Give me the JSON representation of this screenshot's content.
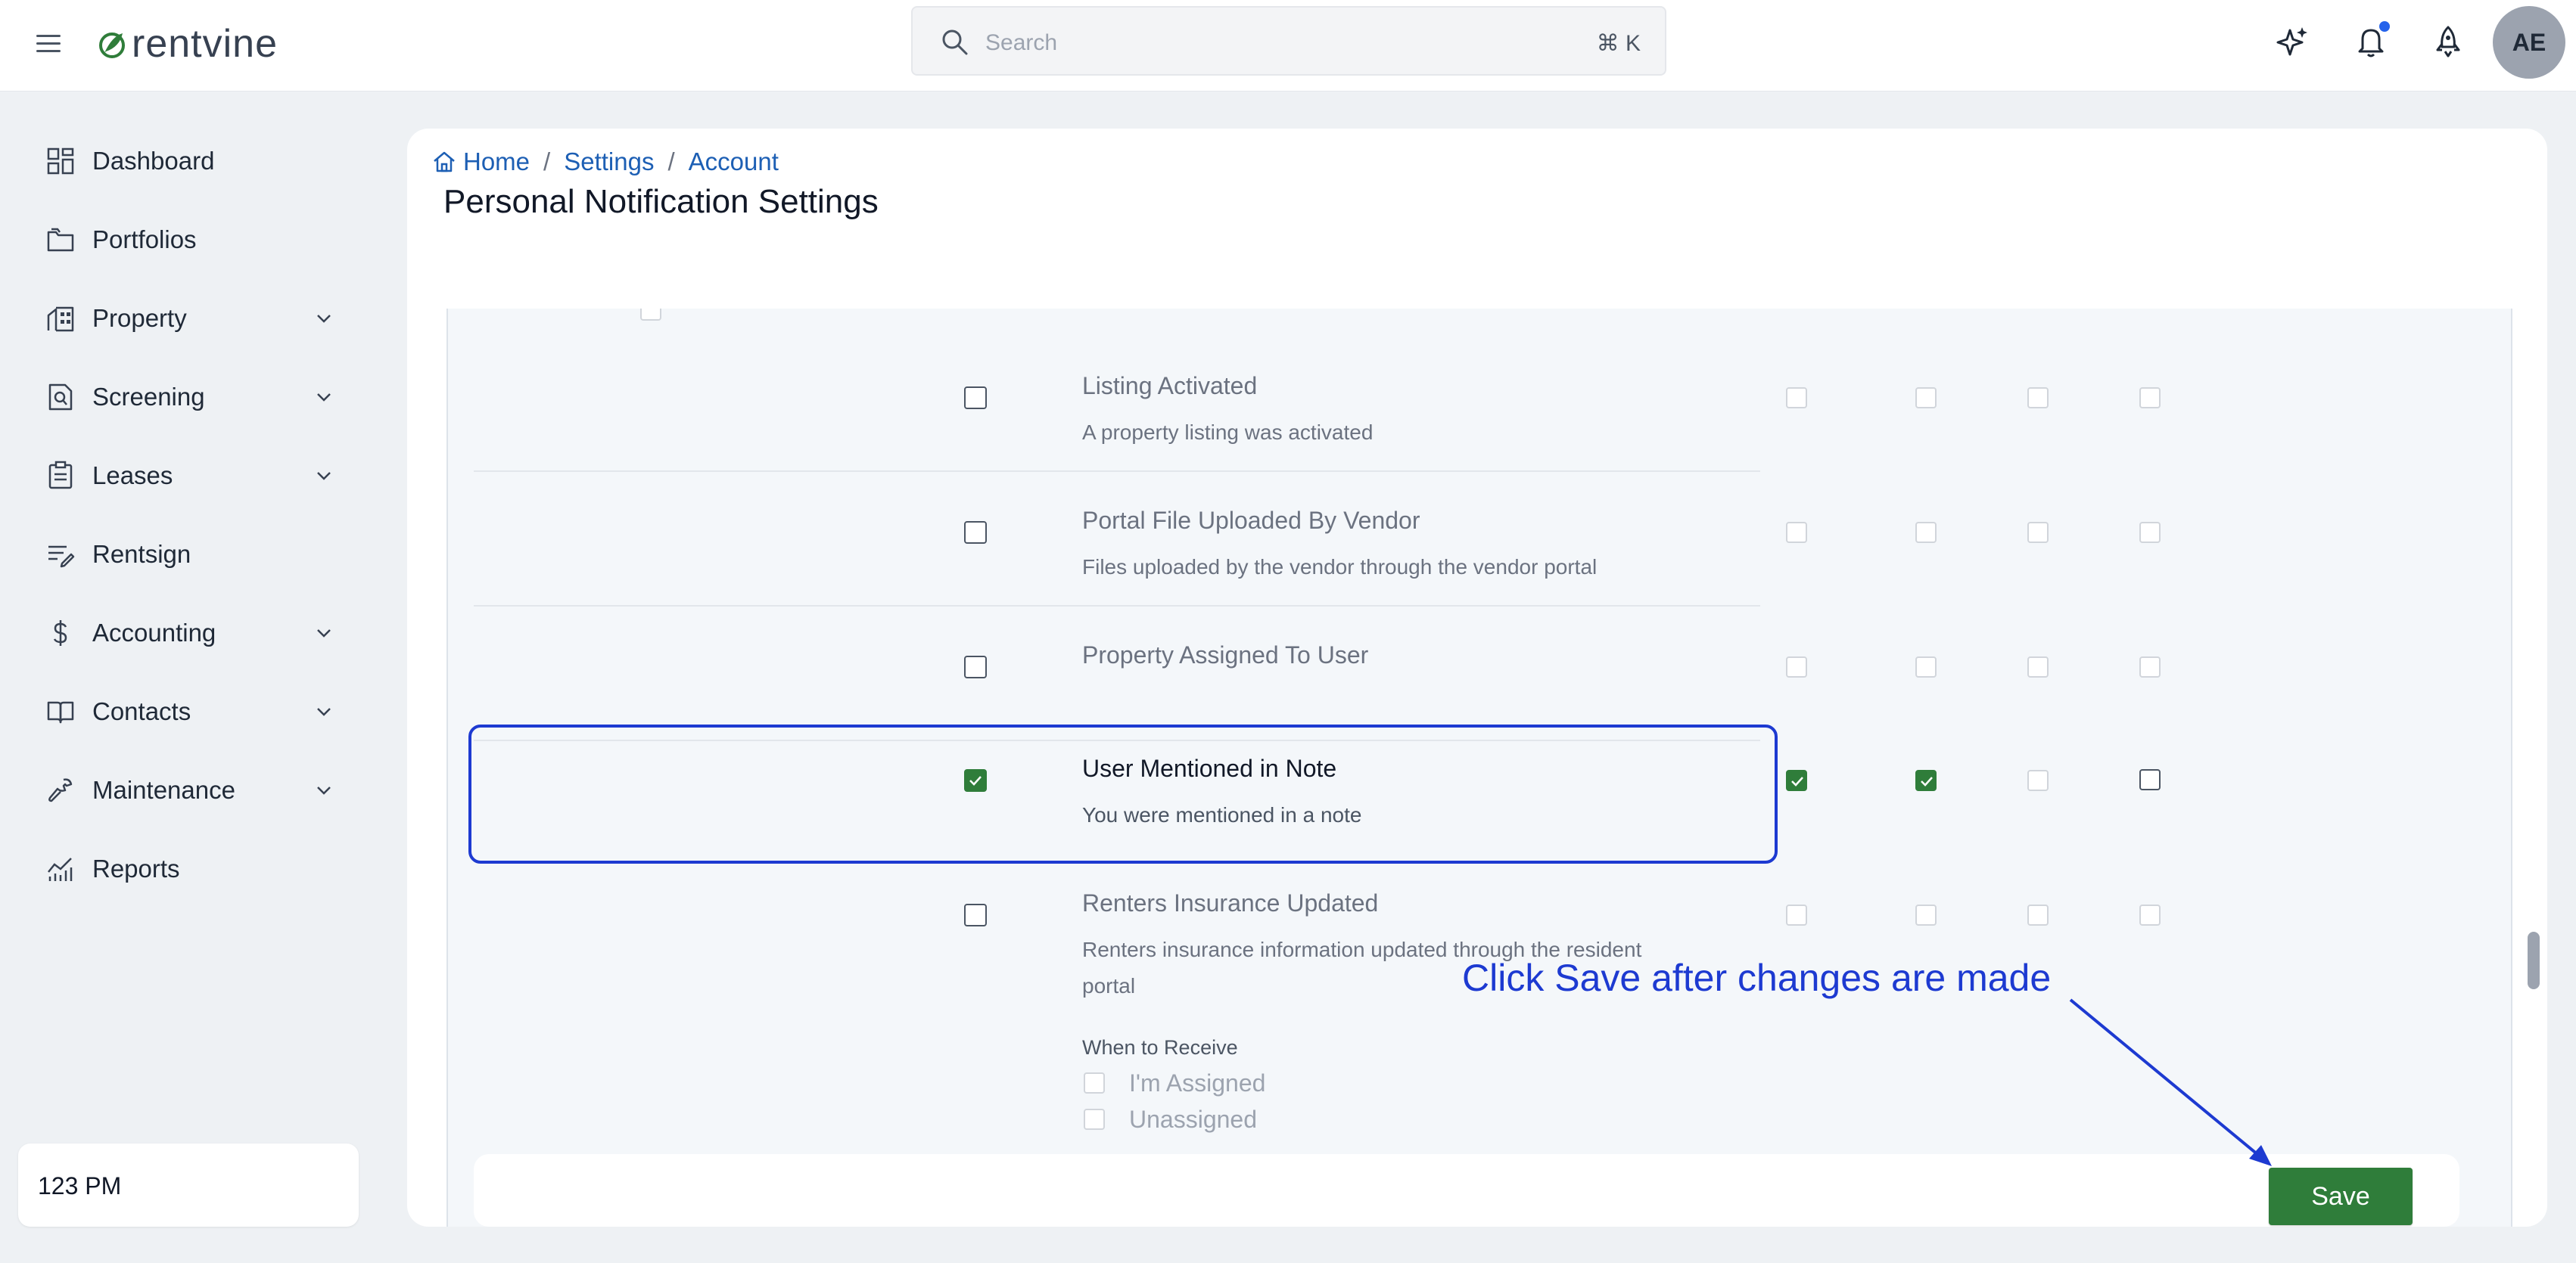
{
  "app": {
    "logo_text": "rentvine"
  },
  "search": {
    "placeholder": "Search",
    "shortcut": "⌘ K"
  },
  "header": {
    "avatar_initials": "AE"
  },
  "sidebar": {
    "items": [
      {
        "label": "Dashboard",
        "icon": "dashboard-icon",
        "expandable": false
      },
      {
        "label": "Portfolios",
        "icon": "folder-icon",
        "expandable": false
      },
      {
        "label": "Property",
        "icon": "building-icon",
        "expandable": true
      },
      {
        "label": "Screening",
        "icon": "screening-icon",
        "expandable": true
      },
      {
        "label": "Leases",
        "icon": "clipboard-icon",
        "expandable": true
      },
      {
        "label": "Rentsign",
        "icon": "sign-icon",
        "expandable": false
      },
      {
        "label": "Accounting",
        "icon": "dollar-icon",
        "expandable": true
      },
      {
        "label": "Contacts",
        "icon": "book-icon",
        "expandable": true
      },
      {
        "label": "Maintenance",
        "icon": "wrench-icon",
        "expandable": true
      },
      {
        "label": "Reports",
        "icon": "chart-icon",
        "expandable": false
      }
    ],
    "time": "123 PM"
  },
  "breadcrumb": {
    "home": "Home",
    "settings": "Settings",
    "account": "Account"
  },
  "page": {
    "title": "Personal Notification Settings"
  },
  "notifications": [
    {
      "title": "Listing Activated",
      "description": "A property listing was activated",
      "enabled": false,
      "channels": [
        false,
        false,
        false,
        false
      ]
    },
    {
      "title": "Portal File Uploaded By Vendor",
      "description": "Files uploaded by the vendor through the vendor portal",
      "enabled": false,
      "channels": [
        false,
        false,
        false,
        false
      ]
    },
    {
      "title": "Property Assigned To User",
      "description": "",
      "enabled": false,
      "channels": [
        false,
        false,
        false,
        false
      ]
    },
    {
      "title": "User Mentioned in Note",
      "description": "You were mentioned in a note",
      "enabled": true,
      "channels": [
        true,
        true,
        false,
        false
      ]
    },
    {
      "title": "Renters Insurance Updated",
      "description_line1": "Renters insurance information updated through the resident",
      "description_line2": "portal",
      "enabled": false,
      "channels": [
        false,
        false,
        false,
        false
      ]
    }
  ],
  "when_to_receive": {
    "label": "When to Receive",
    "options": [
      "I'm Assigned",
      "Unassigned"
    ]
  },
  "annotation": {
    "text": "Click Save after changes are made"
  },
  "actions": {
    "save": "Save"
  },
  "colors": {
    "brand_green": "#2f7d3a",
    "link_blue": "#1d5fb4",
    "annotation_blue": "#1d3ad1"
  }
}
